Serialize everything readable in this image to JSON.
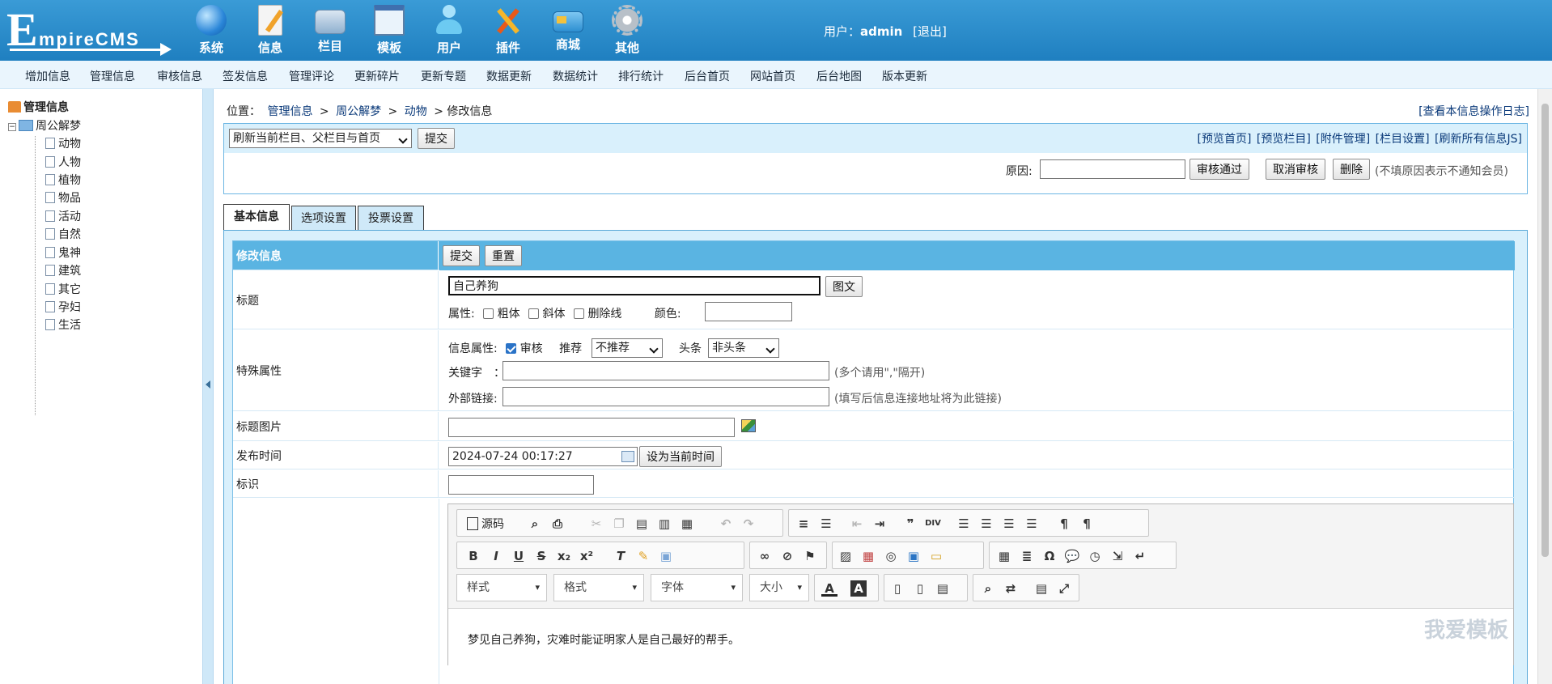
{
  "header": {
    "logo_initial": "E",
    "logo_rest": "mpireCMS",
    "nav": [
      {
        "label": "系统",
        "icon": "globe-icon",
        "color": "#4aa3e8"
      },
      {
        "label": "信息",
        "icon": "document-edit-icon",
        "color": "#f2f2f2"
      },
      {
        "label": "栏目",
        "icon": "folder-icon",
        "color": "#9bb6d1"
      },
      {
        "label": "模板",
        "icon": "window-template-icon",
        "color": "#5e9fd6"
      },
      {
        "label": "用户",
        "icon": "user-icon",
        "color": "#8fd3f5"
      },
      {
        "label": "插件",
        "icon": "tools-icon",
        "color": "#f5a623"
      },
      {
        "label": "商城",
        "icon": "card-icon",
        "color": "#f0c24a"
      },
      {
        "label": "其他",
        "icon": "gear-icon",
        "color": "#b0b8c0"
      }
    ],
    "user_prefix": "用户：",
    "user_name": "admin",
    "logout": "[退出]"
  },
  "submenu": [
    "增加信息",
    "管理信息",
    "审核信息",
    "签发信息",
    "管理评论",
    "更新碎片",
    "更新专题",
    "数据更新",
    "数据统计",
    "排行统计",
    "后台首页",
    "网站首页",
    "后台地图",
    "版本更新"
  ],
  "tree": {
    "root": "管理信息",
    "site": "周公解梦",
    "children": [
      "动物",
      "人物",
      "植物",
      "物品",
      "活动",
      "自然",
      "鬼神",
      "建筑",
      "其它",
      "孕妇",
      "生活"
    ]
  },
  "breadcrumb": {
    "prefix": "位置：",
    "items": [
      "管理信息",
      "周公解梦",
      "动物"
    ],
    "sep": ">",
    "current": "修改信息"
  },
  "oplog": "[查看本信息操作日志]",
  "action": {
    "refresh_select": "刷新当前栏目、父栏目与首页",
    "submit": "提交",
    "links": [
      "[预览首页]",
      "[预览栏目]",
      "[附件管理]",
      "[栏目设置]",
      "[刷新所有信息JS]"
    ],
    "reason_label": "原因:",
    "approve": "审核通过",
    "cancel_approve": "取消审核",
    "delete": "删除",
    "note": "(不填原因表示不通知会员)"
  },
  "tabs": [
    "基本信息",
    "选项设置",
    "投票设置"
  ],
  "form": {
    "header_label": "修改信息",
    "submit": "提交",
    "reset": "重置",
    "title_label": "标题",
    "title_value": "自己养狗",
    "image_text_btn": "图文",
    "attr_label": "属性:",
    "bold": "粗体",
    "italic": "斜体",
    "strike": "删除线",
    "color_label": "颜色:",
    "special_label": "特殊属性",
    "info_attr_label": "信息属性:",
    "audit": "审核",
    "recommend_label": "推荐",
    "recommend_value": "不推荐",
    "headline_label": "头条",
    "headline_value": "非头条",
    "keywords_label": "关键字　：",
    "keywords_hint": "(多个请用\",\"隔开)",
    "link_label": "外部链接:",
    "link_hint": "(填写后信息连接地址将为此链接)",
    "titlepic_label": "标题图片",
    "pubtime_label": "发布时间",
    "pubtime_value": "2024-07-24 00:17:27",
    "set_now": "设为当前时间",
    "mark_label": "标识"
  },
  "editor": {
    "source": "源码",
    "style_combo": "样式",
    "format_combo": "格式",
    "font_combo": "字体",
    "size_combo": "大小",
    "content": "梦见自己养狗，灾难时能证明家人是自己最好的帮手。",
    "watermark": "我爱模板"
  }
}
